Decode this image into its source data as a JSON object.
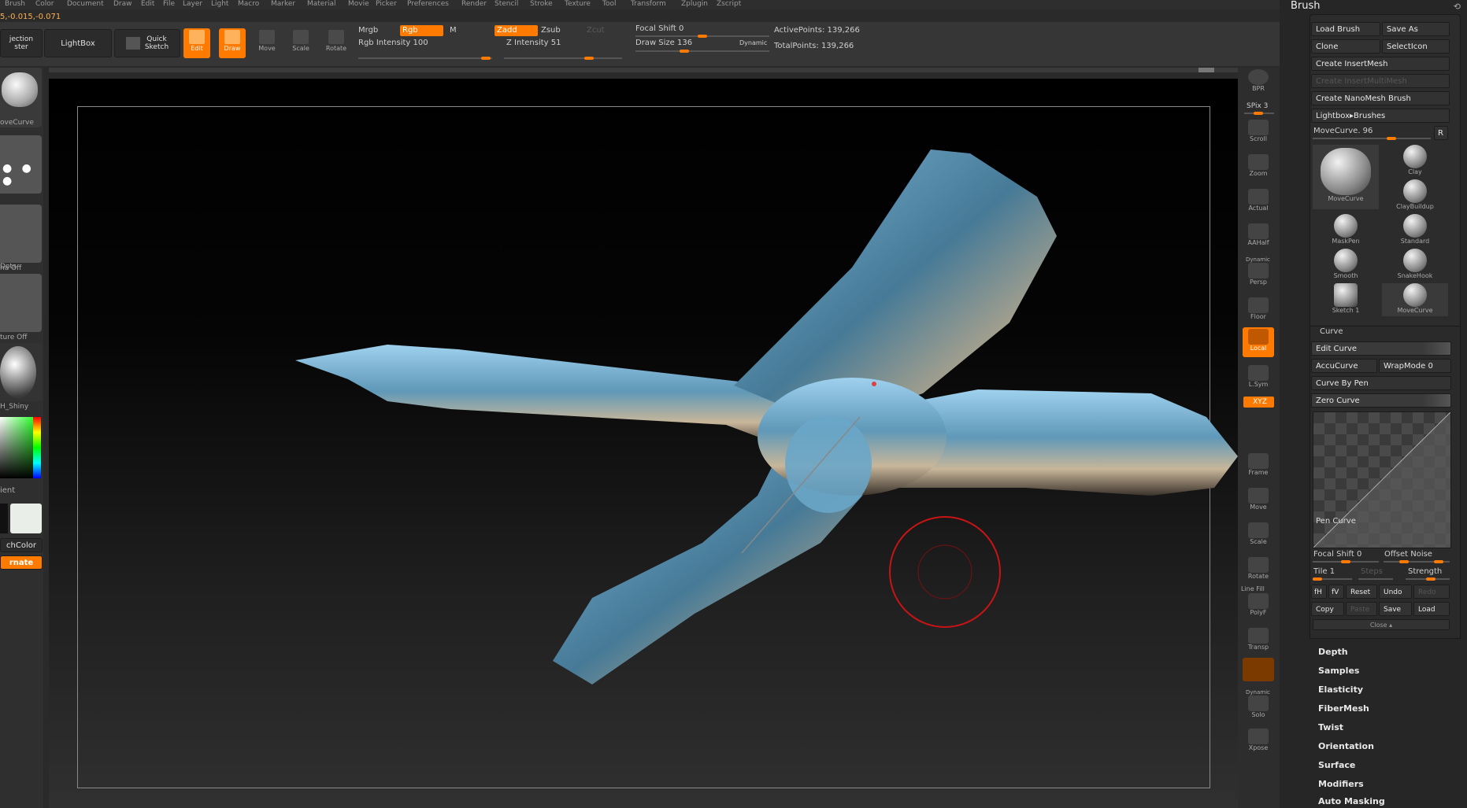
{
  "menu": [
    "Brush",
    "Color",
    "Document",
    "Draw",
    "Edit",
    "File",
    "Layer",
    "Light",
    "Macro",
    "Marker",
    "Material",
    "Movie",
    "Picker",
    "Preferences",
    "Render",
    "Stencil",
    "Stroke",
    "Texture",
    "Tool",
    "Transform",
    "Zplugin",
    "Zscript"
  ],
  "coordinates": "5,-0.015,-0.071",
  "topbar": {
    "projection_master": "jection\nster",
    "lightbox": "LightBox",
    "quick_sketch": "Quick\nSketch",
    "tools": [
      "Edit",
      "Draw",
      "Move",
      "Scale",
      "Rotate"
    ],
    "mrgb": "Mrgb",
    "rgb": "Rgb",
    "m": "M",
    "zadd": "Zadd",
    "zsub": "Zsub",
    "zcut": "Zcut",
    "rgb_intensity": "Rgb Intensity 100",
    "z_intensity": "Z Intensity 51",
    "focal_shift": "Focal Shift 0",
    "draw_size": "Draw Size 136",
    "dynamic": "Dynamic",
    "active_points": "ActivePoints: 139,266",
    "total_points": "TotalPoints: 139,266"
  },
  "left_shelf": {
    "brush_label": "oveCurve",
    "stroke_label": "Dots",
    "alpha_label": "ha  Off",
    "texture_label": "ture  Off",
    "material_label": "H_Shiny",
    "gradient_label": "ient",
    "switch_color": "chColor",
    "alternate": "rnate"
  },
  "right_shelf": {
    "bpr": "BPR",
    "spix": "SPix 3",
    "tools": [
      "Scroll",
      "Zoom",
      "Actual",
      "AAHalf",
      "Persp",
      "Floor",
      "Local",
      "L.Sym",
      "XYZ",
      "Frame",
      "Move",
      "Scale",
      "Rotate",
      "PolyF",
      "Transp",
      "Solo",
      "Xpose"
    ],
    "dynamic_label": "Dynamic",
    "line_fill": "Line Fill"
  },
  "brush_panel": {
    "title": "Brush",
    "load_brush": "Load Brush",
    "save_as": "Save As",
    "clone": "Clone",
    "select_icon": "SelectIcon",
    "create_insertmesh": "Create InsertMesh",
    "create_insertmultimesh": "Create InsertMultiMesh",
    "create_nanomesh": "Create NanoMesh Brush",
    "lightbox_brushes": "Lightbox▸Brushes",
    "current_brush": "MoveCurve. 96",
    "r_button": "R",
    "brushes": [
      "MoveCurve",
      "Clay",
      "ClayBuildup",
      "MaskPen",
      "Standard",
      "Smooth",
      "SnakeHook",
      "Sketch 1",
      "MoveCurve"
    ],
    "curve_header": "Curve",
    "edit_curve": "Edit Curve",
    "accucurve": "AccuCurve",
    "wrapmode": "WrapMode 0",
    "curve_by_pen": "Curve By Pen",
    "zero_curve": "Zero Curve",
    "pen_curve": "Pen Curve",
    "focal_shift": "Focal Shift 0",
    "offset_noise": "Offset Noise",
    "tile": "Tile 1",
    "steps": "Steps",
    "strength": "Strength",
    "fh": "fH",
    "fv": "fV",
    "reset": "Reset",
    "undo": "Undo",
    "redo": "Redo",
    "copy": "Copy",
    "paste": "Paste",
    "save": "Save",
    "load": "Load",
    "close": "Close ▴",
    "submenus": [
      "Depth",
      "Samples",
      "Elasticity",
      "FiberMesh",
      "Twist",
      "Orientation",
      "Surface",
      "Modifiers",
      "Auto Masking"
    ]
  },
  "colors": {
    "accent": "#ff7a00",
    "panel": "#262626",
    "cursor": "#c81414"
  }
}
